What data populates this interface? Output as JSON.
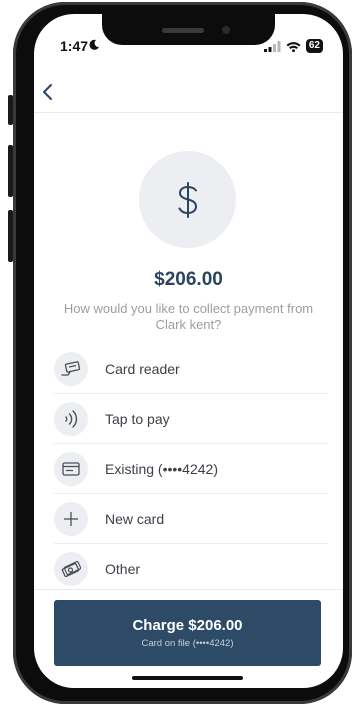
{
  "status_bar": {
    "time": "1:47",
    "battery": "62",
    "icons": [
      "moon-icon",
      "signal-icon",
      "wifi-icon",
      "battery-icon"
    ]
  },
  "nav": {
    "back_icon": "chevron-left-icon"
  },
  "hero_icon": "dollar-icon",
  "amount": "$206.00",
  "prompt": "How would you like to collect payment from Clark kent?",
  "options": [
    {
      "label": "Card reader",
      "icon": "card-reader-icon"
    },
    {
      "label": "Tap to pay",
      "icon": "contactless-icon"
    },
    {
      "label": "Existing (••••4242)",
      "icon": "card-icon"
    },
    {
      "label": "New card",
      "icon": "plus-icon"
    },
    {
      "label": "Other",
      "icon": "cash-icon"
    }
  ],
  "charge_button": {
    "label": "Charge $206.00",
    "sublabel": "Card on file (••••4242)"
  },
  "colors": {
    "accent": "#2d4a67",
    "amount_text": "#2b4460",
    "icon_bg": "#eceef1"
  }
}
